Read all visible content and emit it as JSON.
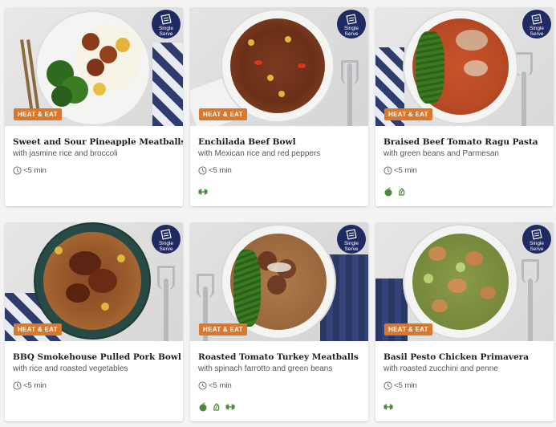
{
  "colors": {
    "badge": "#d9782d",
    "single_serve": "#1f2a63",
    "attribute_green": "#4c8b3a"
  },
  "cards": [
    {
      "title": "Sweet and Sour Pineapple Meatballs",
      "subtitle": "with jasmine rice and broccoli",
      "badge": "HEAT & EAT",
      "serve_line1": "Single",
      "serve_line2": "Serve",
      "time": "<5 min",
      "attributes": []
    },
    {
      "title": "Enchilada Beef Bowl",
      "subtitle": "with Mexican rice and red peppers",
      "badge": "HEAT & EAT",
      "serve_line1": "Single",
      "serve_line2": "Serve",
      "time": "<5 min",
      "attributes": [
        "protein-icon"
      ]
    },
    {
      "title": "Braised Beef Tomato Ragu Pasta",
      "subtitle": "with green beans and Parmesan",
      "badge": "HEAT & EAT",
      "serve_line1": "Single",
      "serve_line2": "Serve",
      "time": "<5 min",
      "attributes": [
        "apple-icon",
        "fiber-icon"
      ]
    },
    {
      "title": "BBQ Smokehouse Pulled Pork Bowl",
      "subtitle": "with rice and roasted vegetables",
      "badge": "HEAT & EAT",
      "serve_line1": "Single",
      "serve_line2": "Serve",
      "time": "<5 min",
      "attributes": []
    },
    {
      "title": "Roasted Tomato Turkey Meatballs",
      "subtitle": "with spinach farrotto and green beans",
      "badge": "HEAT & EAT",
      "serve_line1": "Single",
      "serve_line2": "Serve",
      "time": "<5 min",
      "attributes": [
        "apple-icon",
        "fiber-icon",
        "protein-icon"
      ]
    },
    {
      "title": "Basil Pesto Chicken Primavera",
      "subtitle": "with roasted zucchini and penne",
      "badge": "HEAT & EAT",
      "serve_line1": "Single",
      "serve_line2": "Serve",
      "time": "<5 min",
      "attributes": [
        "protein-icon"
      ]
    }
  ]
}
